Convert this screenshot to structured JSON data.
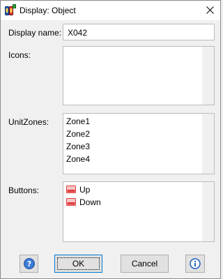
{
  "window": {
    "title": "Display: Object"
  },
  "form": {
    "display_name_label": "Display name:",
    "display_name_value": "X042",
    "icons_label": "Icons:",
    "unitzones_label": "UnitZones:",
    "unitzones": [
      "Zone1",
      "Zone2",
      "Zone3",
      "Zone4"
    ],
    "buttons_label": "Buttons:",
    "buttons": [
      {
        "label": "Up",
        "icon": "red-button-icon"
      },
      {
        "label": "Down",
        "icon": "red-button-icon"
      }
    ]
  },
  "footer": {
    "help_icon": "question-icon",
    "ok_label": "OK",
    "cancel_label": "Cancel",
    "info_icon": "info-icon"
  },
  "colors": {
    "accent": "#0078d7",
    "help_blue": "#3a7bd5",
    "button_icon_red": "#e03a3a"
  }
}
